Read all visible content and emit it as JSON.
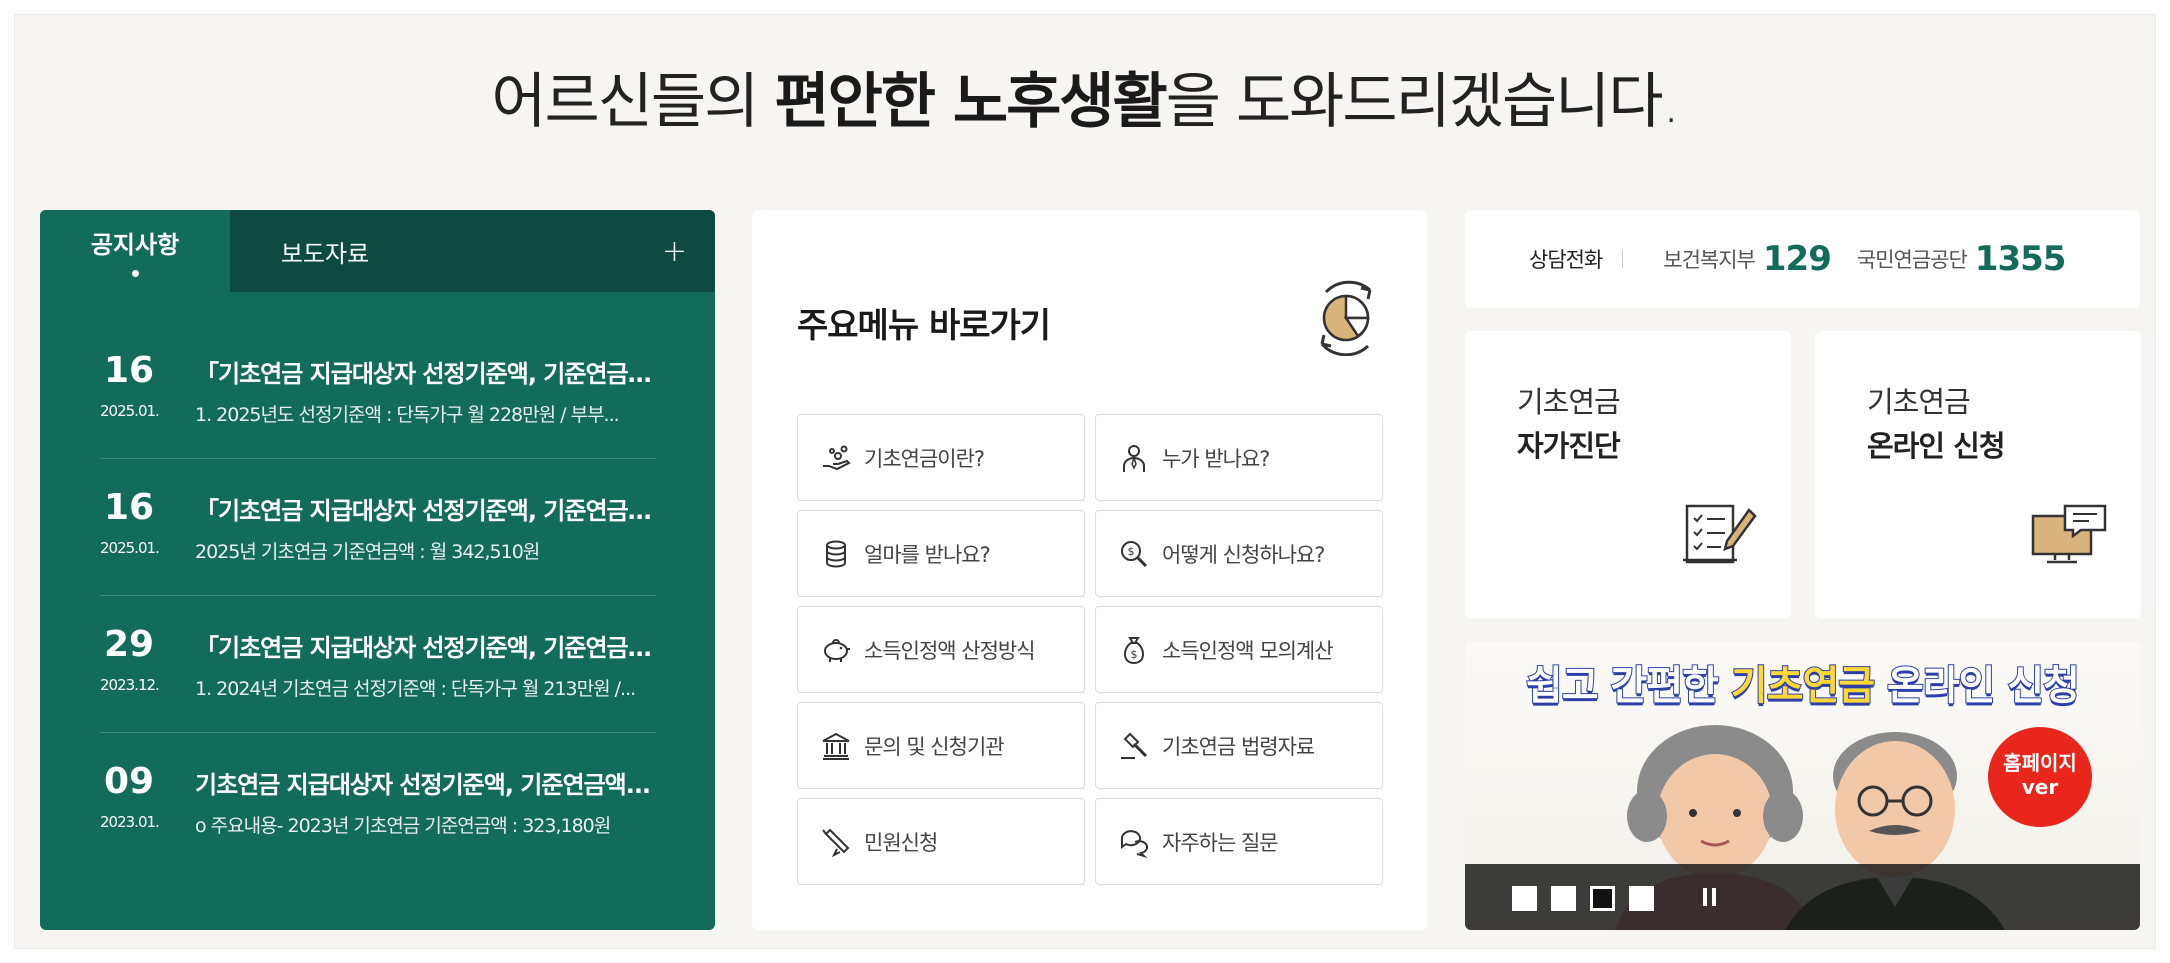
{
  "headline": {
    "pre": "어르신들의 ",
    "bold": "편안한 노후생활",
    "post": "을 도와드리겠습니다."
  },
  "notice": {
    "tabs": [
      {
        "label": "공지사항",
        "active": true
      },
      {
        "label": "보도자료",
        "active": false
      }
    ],
    "more_label": "+",
    "items": [
      {
        "day": "16",
        "ym": "2025.01.",
        "title": "「기초연금 지급대상자 선정기준액, 기준연금액...",
        "summary": "1. 2025년도 선정기준액 : 단독가구 월 228만원 / 부부..."
      },
      {
        "day": "16",
        "ym": "2025.01.",
        "title": "「기초연금 지급대상자 선정기준액, 기준연금액...",
        "summary": "2025년 기초연금 기준연금액 : 월 342,510원"
      },
      {
        "day": "29",
        "ym": "2023.12.",
        "title": "「기초연금 지급대상자 선정기준액, 기준연금액...",
        "summary": "1. 2024년 기초연금 선정기준액 : 단독가구 월 213만원 /..."
      },
      {
        "day": "09",
        "ym": "2023.01.",
        "title": "기초연금 지급대상자 선정기준액, 기준연금액...",
        "summary": "o 주요내용- 2023년 기초연금 기준연금액 : 323,180원"
      }
    ]
  },
  "menu": {
    "title_bold": "주요메뉴",
    "title_rest": " 바로가기",
    "items": [
      {
        "label": "기초연금이란?",
        "icon": "hand-coins-icon"
      },
      {
        "label": "누가 받나요?",
        "icon": "person-icon"
      },
      {
        "label": "얼마를 받나요?",
        "icon": "coin-stack-icon"
      },
      {
        "label": "어떻게 신청하나요?",
        "icon": "magnifier-money-icon"
      },
      {
        "label": "소득인정액 산정방식",
        "icon": "piggy-bank-icon"
      },
      {
        "label": "소득인정액 모의계산",
        "icon": "money-bag-icon"
      },
      {
        "label": "문의 및 신청기관",
        "icon": "institution-icon"
      },
      {
        "label": "기초연금 법령자료",
        "icon": "gavel-icon"
      },
      {
        "label": "민원신청",
        "icon": "pen-icon"
      },
      {
        "label": "자주하는 질문",
        "icon": "chat-bubbles-icon"
      }
    ]
  },
  "phone": {
    "label": "상담전화",
    "orgs": [
      {
        "name": "보건복지부",
        "number": "129"
      },
      {
        "name": "국민연금공단",
        "number": "1355"
      }
    ]
  },
  "cards": [
    {
      "top": "기초연금",
      "bottom": "자가진단",
      "icon": "checklist-pencil-icon"
    },
    {
      "top": "기초연금",
      "bottom": "온라인 신청",
      "icon": "monitor-chat-icon"
    }
  ],
  "banner": {
    "title_a": "쉽고 간편한 ",
    "title_b": "기초연금",
    "title_c": " 온라인 신청",
    "badge_1": "홈페이지",
    "badge_2": "ver",
    "active_slide": 3,
    "slide_count": 4
  },
  "colors": {
    "primary": "#136b5a",
    "primary_dark": "#0d4b40",
    "background": "#f6f5f2",
    "accent_gold": "#d9b47c"
  }
}
